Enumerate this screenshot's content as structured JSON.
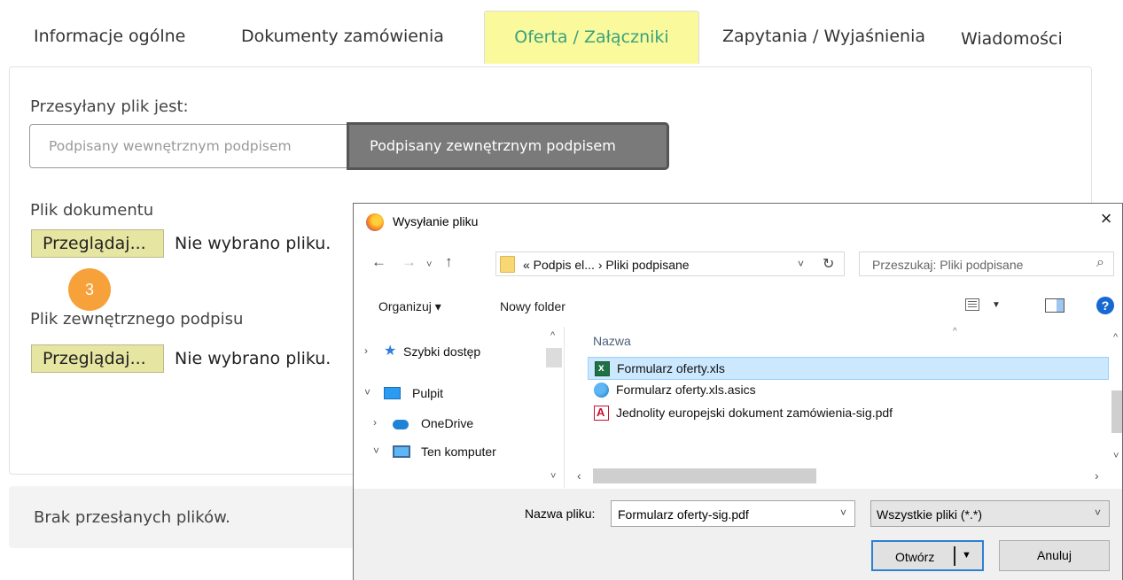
{
  "tabs": [
    {
      "label": "Informacje ogólne"
    },
    {
      "label": "Dokumenty zamówienia"
    },
    {
      "label": "Oferta / Załączniki",
      "active": true
    },
    {
      "label": "Zapytania / Wyjaśnienia"
    },
    {
      "label": "Wiadomości"
    }
  ],
  "upload": {
    "signature_label": "Przesyłany plik jest:",
    "option_internal": "Podpisany wewnętrznym podpisem",
    "option_external": "Podpisany zewnętrznym podpisem",
    "selected_option": "external",
    "document_label": "Plik dokumentu",
    "browse_label": "Przeglądaj...",
    "no_file_document": "Nie wybrano pliku.",
    "step_number": "3",
    "signature_file_label": "Plik zewnętrznego podpisu",
    "browse_label_2": "Przeglądaj...",
    "no_file_signature": "Nie wybrano pliku."
  },
  "files_status": "Brak przesłanych plików.",
  "dialog": {
    "title": "Wysyłanie pliku",
    "close": "×",
    "nav": {
      "back": "←",
      "forward": "→",
      "recent": "˅",
      "up": "↑"
    },
    "breadcrumb": "« Podpis el... › Pliki podpisane",
    "refresh": "↻",
    "search_placeholder": "Przeszukaj: Pliki podpisane",
    "toolbar": {
      "organize": "Organizuj ▾",
      "new_folder": "Nowy folder",
      "help": "?"
    },
    "nav_tree": [
      {
        "arrow": "›",
        "label": "Szybki dostęp",
        "icon": "star-icon"
      },
      {
        "arrow": "˅",
        "label": "Pulpit",
        "icon": "desktop-icon"
      },
      {
        "arrow": "›",
        "label": "OneDrive",
        "icon": "cloud-icon"
      },
      {
        "arrow": "˅",
        "label": "Ten komputer",
        "icon": "computer-icon"
      }
    ],
    "column_name": "Nazwa",
    "files": [
      {
        "name": "Formularz oferty.xls",
        "icon": "excel-file-icon",
        "selected": true
      },
      {
        "name": "Formularz oferty.xls.asics",
        "icon": "asics-file-icon",
        "selected": false
      },
      {
        "name": "Jednolity europejski dokument zamówienia-sig.pdf",
        "icon": "pdf-file-icon",
        "selected": false
      }
    ],
    "filename_label": "Nazwa pliku:",
    "filename_value": "Formularz oferty-sig.pdf",
    "filetype_value": "Wszystkie pliki (*.*)",
    "open_label": "Otwórz",
    "cancel_label": "Anuluj"
  }
}
